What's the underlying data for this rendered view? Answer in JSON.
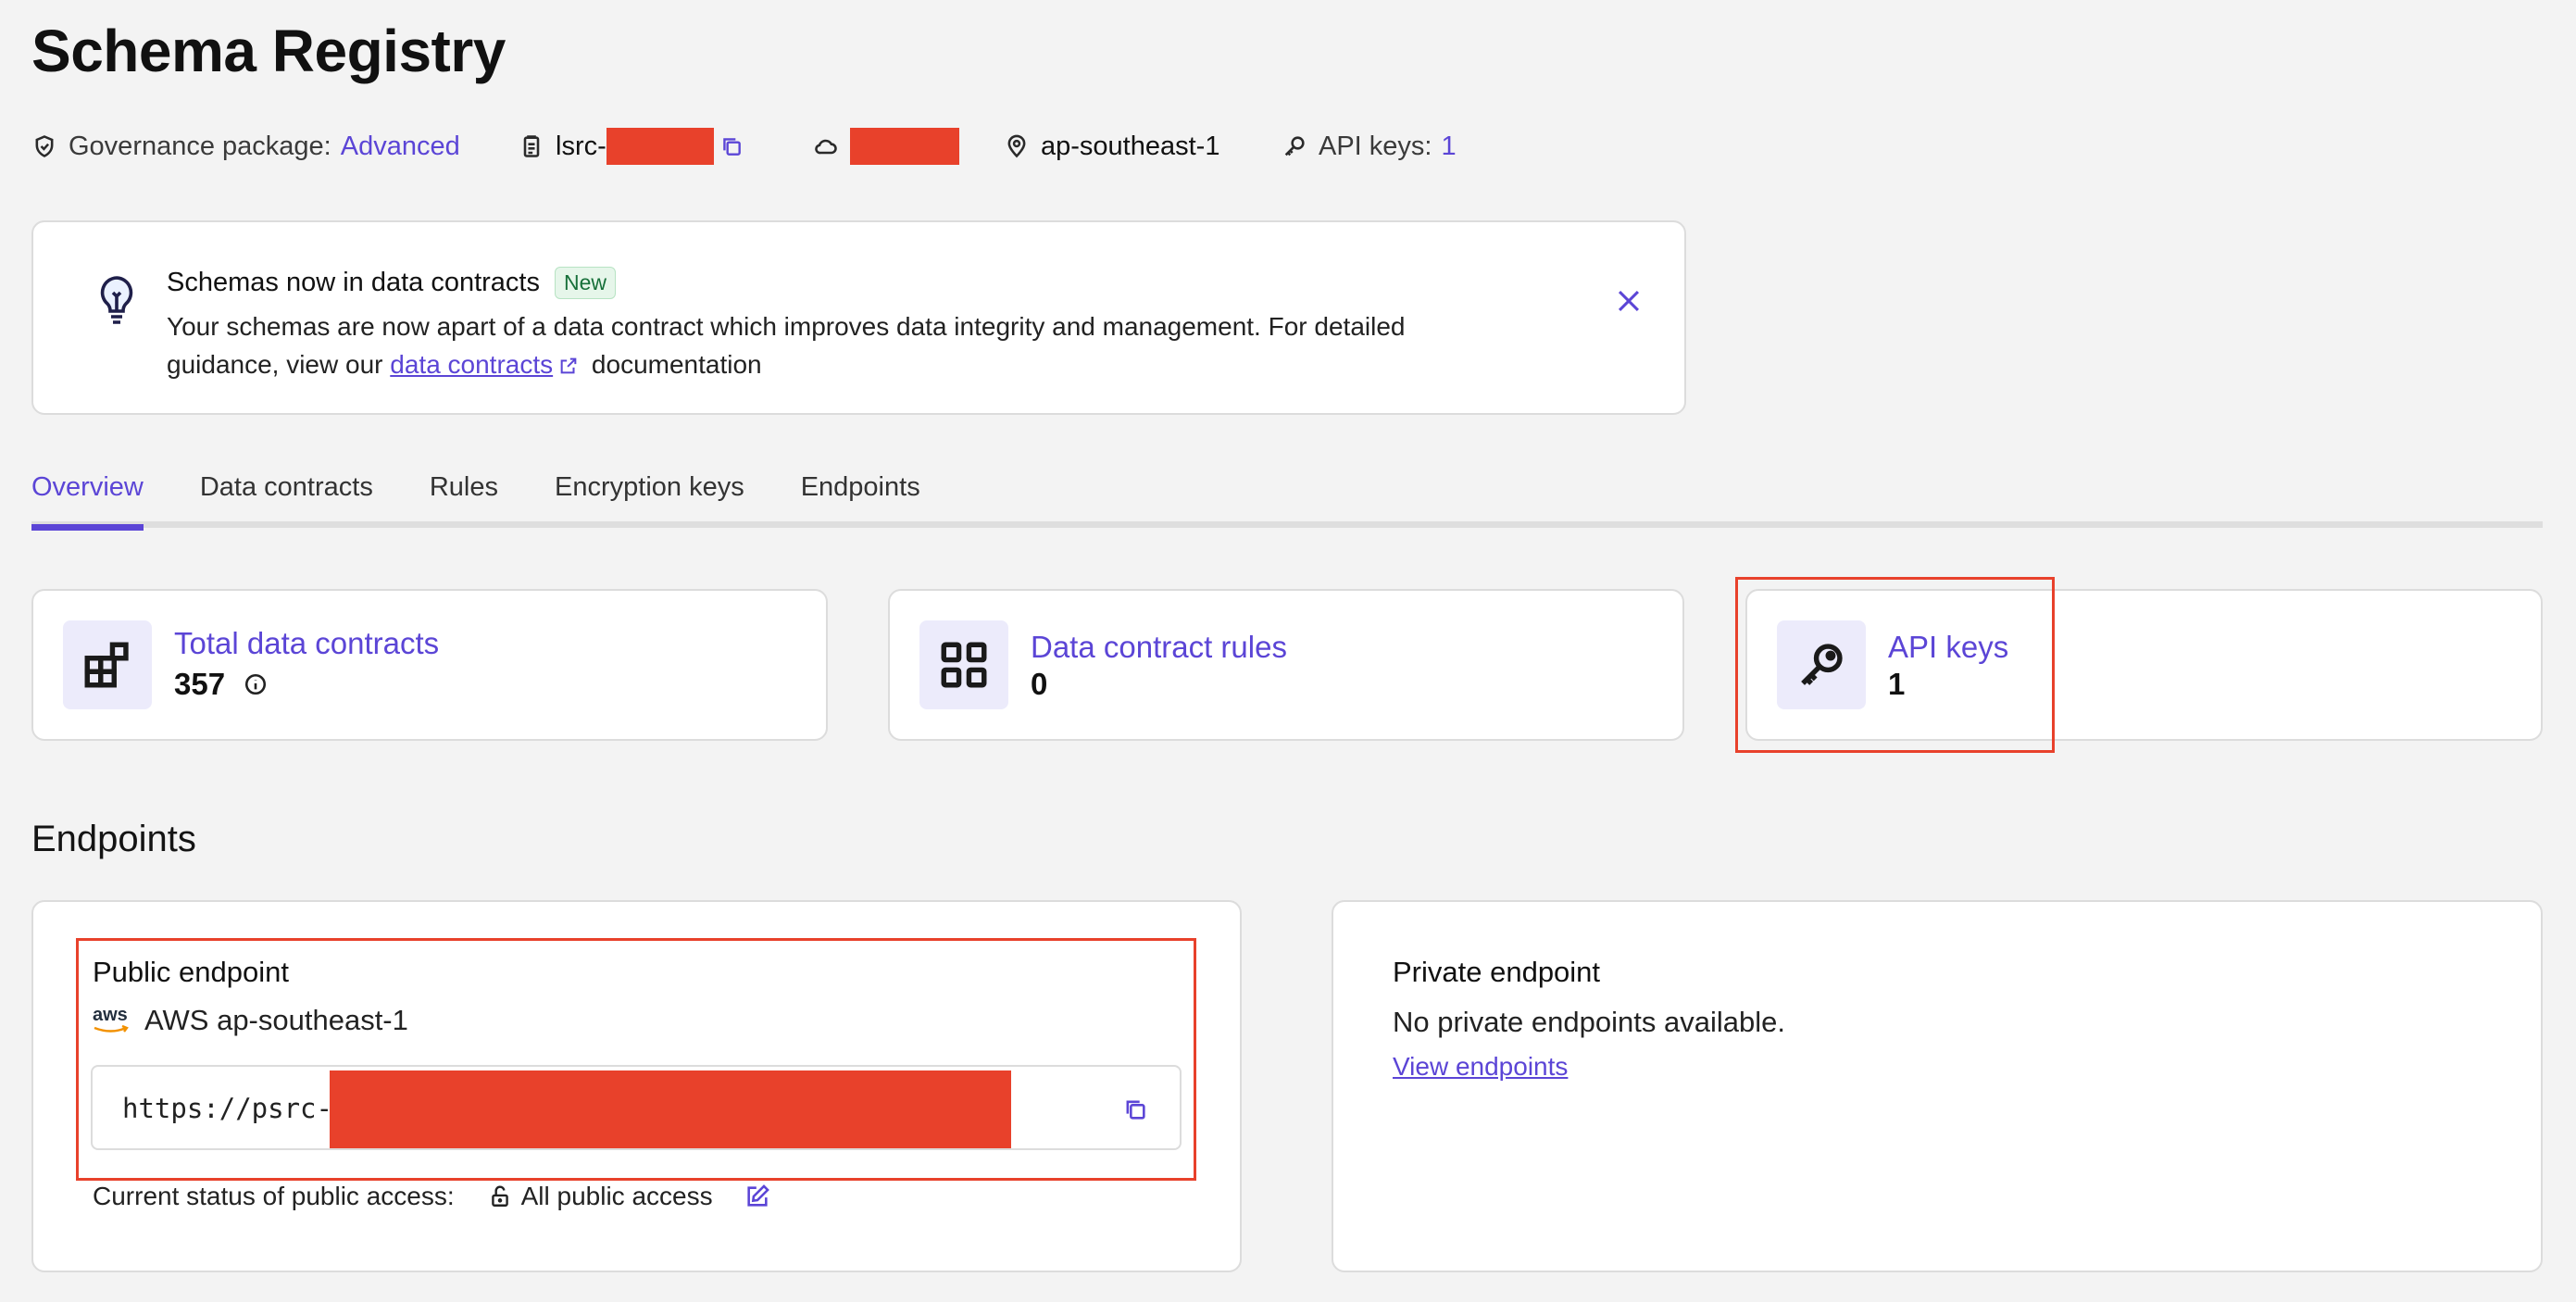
{
  "page": {
    "title": "Schema Registry"
  },
  "meta": {
    "governance_label": "Governance package:",
    "governance_value": "Advanced",
    "cluster_id_prefix": "lsrc-",
    "region": "ap-southeast-1",
    "api_keys_label": "API keys:",
    "api_keys_value": "1"
  },
  "banner": {
    "title": "Schemas now in data contracts",
    "badge": "New",
    "body_before": "Your schemas are now apart of a data contract which improves data integrity and management. For detailed guidance, view our",
    "link": "data contracts",
    "body_after": "documentation"
  },
  "tabs": [
    {
      "label": "Overview",
      "active": true
    },
    {
      "label": "Data contracts"
    },
    {
      "label": "Rules"
    },
    {
      "label": "Encryption keys"
    },
    {
      "label": "Endpoints"
    }
  ],
  "stats": [
    {
      "label": "Total data contracts",
      "value": "357",
      "icon": "blocks-icon"
    },
    {
      "label": "Data contract rules",
      "value": "0",
      "icon": "grid-icon"
    },
    {
      "label": "API keys",
      "value": "1",
      "icon": "key-icon"
    }
  ],
  "endpoints": {
    "section_title": "Endpoints",
    "public": {
      "title": "Public endpoint",
      "provider_logo": "aws",
      "provider": "AWS ap-southeast-1",
      "url_prefix": "https://psrc-",
      "status_label": "Current status of public access:",
      "status_value": "All public access"
    },
    "private": {
      "title": "Private endpoint",
      "message": "No private endpoints available.",
      "link": "View endpoints"
    }
  },
  "colors": {
    "accent": "#5b45d6",
    "highlight": "#e8412b",
    "background": "#f3f3f3"
  }
}
